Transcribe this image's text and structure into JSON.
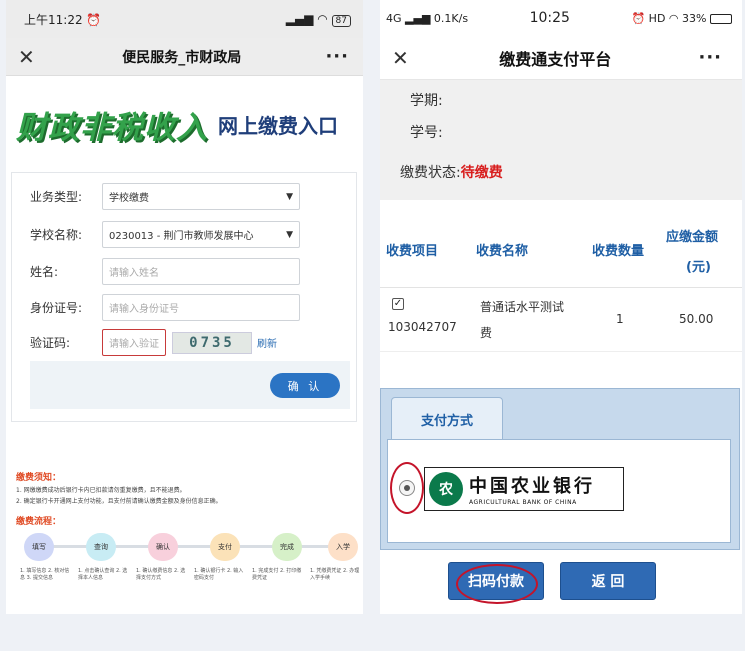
{
  "left": {
    "status": {
      "time": "上午11:22",
      "clock_icon": "alarm-icon",
      "signal": "signal-icon",
      "wifi": "wifi-icon",
      "battery": "87"
    },
    "nav": {
      "title": "便民服务_市财政局",
      "close": "✕",
      "more": "···"
    },
    "banner": {
      "title": "财政非税收入",
      "subtitle": "网上缴费入口"
    },
    "form": {
      "business_type_label": "业务类型:",
      "business_type_value": "学校缴费",
      "school_label": "学校名称:",
      "school_value": "0230013 - 荆门市教师发展中心",
      "name_label": "姓名:",
      "name_placeholder": "请输入姓名",
      "id_label": "身份证号:",
      "id_placeholder": "请输入身份证号",
      "captcha_label": "验证码:",
      "captcha_placeholder": "请输入验证",
      "captcha_image": "0735",
      "refresh": "刷新",
      "confirm": "确 认"
    },
    "notice": {
      "title": "缴费须知：",
      "line1": "1. 网缴缴费成功后银行卡内已扣款请勿重复缴费，且不能退费。",
      "line2": "2. 确定银行卡开通网上支付功能，且支付前请确认缴费金额及身份信息正确。"
    },
    "flow": {
      "title": "缴费流程：",
      "steps": [
        "填写",
        "查询",
        "确认",
        "支付",
        "完成",
        "入学"
      ],
      "descs": [
        "1. 填写信息 2. 核对信息 3. 提交信息",
        "1. 点击确认查询 2. 选择本人信息",
        "1. 确认缴费信息 2. 选择支付方式",
        "1. 确认银行卡 2. 输入密码支付",
        "1. 完成支付 2. 打印缴费凭证",
        "1. 凭缴费凭证 2. 办理入学手续"
      ]
    }
  },
  "right": {
    "status": {
      "network": "4G",
      "speed": "0.1K/s",
      "time": "10:25",
      "hd": "HD",
      "battery": "33%"
    },
    "nav": {
      "title": "缴费通支付平台",
      "close": "✕",
      "more": "···"
    },
    "info": {
      "term_label": "学期:",
      "student_no_label": "学号:",
      "status_label": "缴费状态:",
      "status_value": "待缴费"
    },
    "table": {
      "headers": {
        "item": "收费项目",
        "name": "收费名称",
        "qty": "收费数量",
        "amount_line1": "应缴金额",
        "amount_line2": "(元)"
      },
      "rows": [
        {
          "checked": true,
          "code": "103042707",
          "name_line1": "普通话水平测试",
          "name_line2": "费",
          "qty": "1",
          "amount": "50.00"
        }
      ]
    },
    "payment": {
      "tab": "支付方式",
      "bank_cn": "中国农业银行",
      "bank_en": "AGRICULTURAL BANK OF CHINA"
    },
    "buttons": {
      "scan_pay": "扫码付款",
      "back": "返 回"
    }
  },
  "colors": {
    "accent_blue": "#2f6ab4",
    "status_red": "#d81e1e",
    "highlight_red": "#c4142a",
    "banner_green": "#33a24b"
  }
}
